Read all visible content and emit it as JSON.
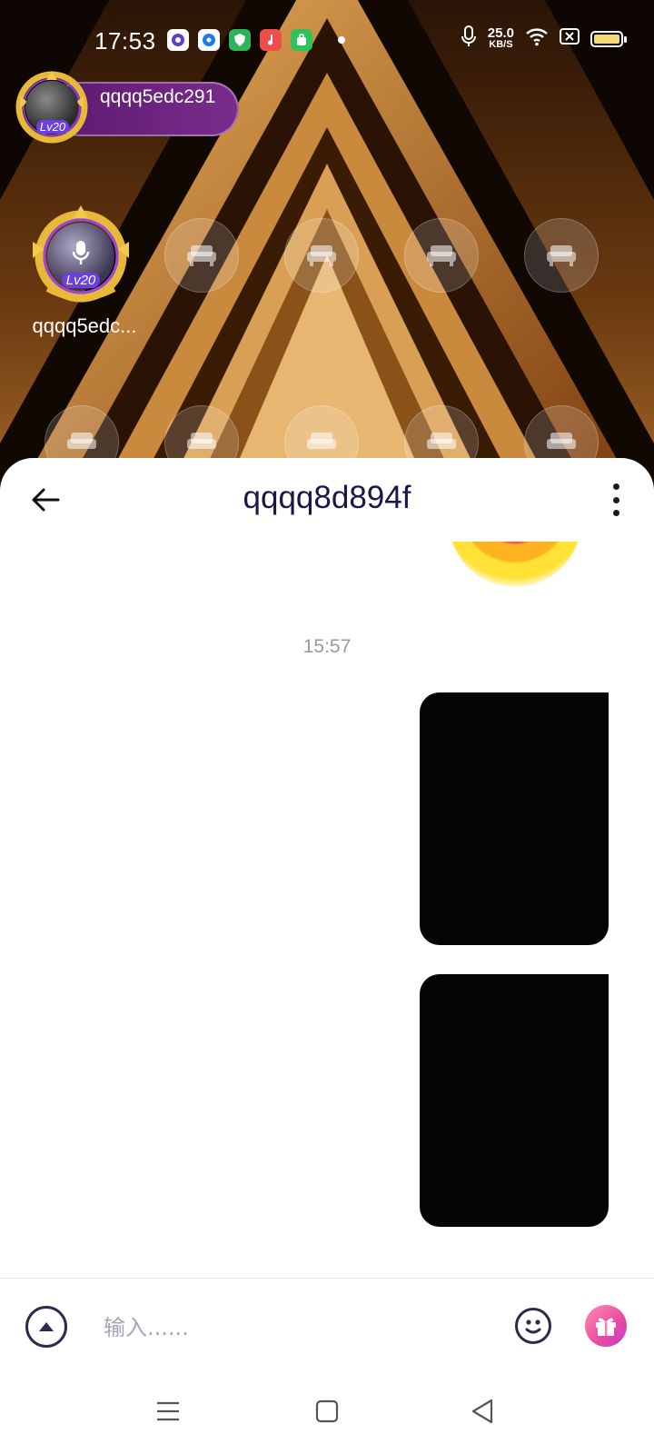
{
  "status_bar": {
    "time": "17:53",
    "net_speed_value": "25.0",
    "net_speed_unit": "KB/S",
    "icons": [
      "mic-icon",
      "wifi-icon",
      "sim-off-icon",
      "battery-icon"
    ],
    "notification_icons": [
      "app-notif-icon-1",
      "app-notif-icon-2",
      "shield-notif-icon",
      "music-notif-icon",
      "shop-notif-icon"
    ]
  },
  "room": {
    "host": {
      "name": "qqqq5edc291",
      "level": "Lv20"
    },
    "seats": {
      "occupied": {
        "name": "qqqq5edc...",
        "level": "Lv20"
      },
      "empty_seat_icon": "sofa-icon"
    }
  },
  "chat": {
    "title": "qqqq8d894f",
    "timestamp": "15:57",
    "image_messages": [
      {
        "type": "image",
        "color": "#050403"
      },
      {
        "type": "image",
        "color": "#050403"
      }
    ]
  },
  "input": {
    "placeholder": "输入......"
  },
  "colors": {
    "title": "#1f1446",
    "accent_gift": "#e94aa0",
    "host_pill": "#6a2380"
  }
}
